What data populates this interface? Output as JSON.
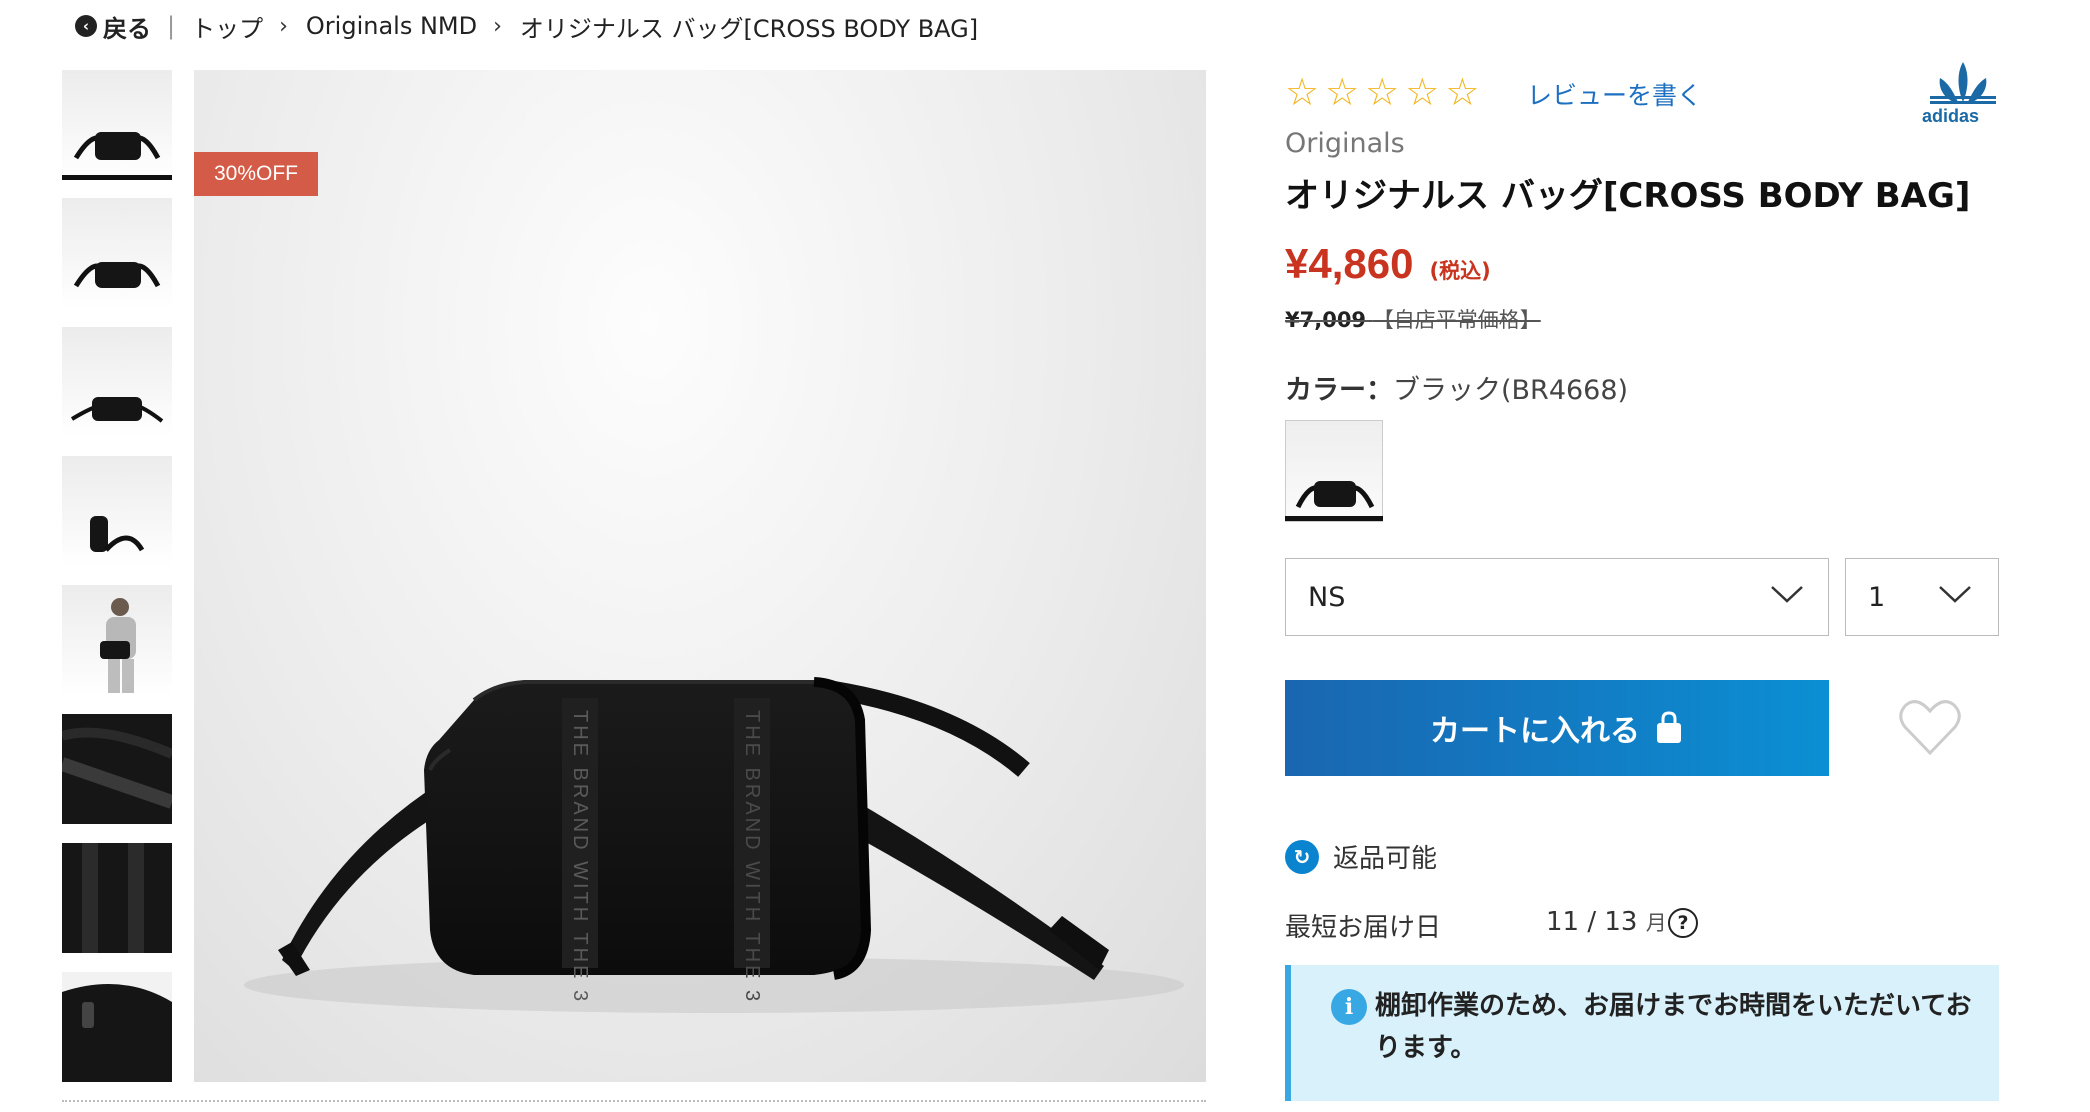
{
  "breadcrumb": {
    "back_label": "戻る",
    "separator": "|",
    "items": [
      "トップ",
      "Originals NMD",
      "オリジナルス バッグ[CROSS BODY BAG]"
    ]
  },
  "gallery": {
    "thumbnail_count": 8,
    "active_index": 0,
    "badge": "30%OFF",
    "bag_print_text": "THE BRAND WITH THE 3"
  },
  "product": {
    "rating_stars": 5,
    "rating_value": 0,
    "review_link": "レビューを書く",
    "brand": "adidas",
    "category": "Originals",
    "title": "オリジナルス バッグ[CROSS BODY BAG]",
    "price": "¥4,860",
    "tax_note": "(税込)",
    "original_price": "¥7,009",
    "original_price_note": "【自店平常価格】",
    "color_label": "カラー：",
    "color_value": "ブラック(BR4668)"
  },
  "size_select": {
    "value": "NS"
  },
  "quantity_select": {
    "value": "1"
  },
  "cart_button": {
    "label": "カートに入れる"
  },
  "returns": {
    "label": "返品可能"
  },
  "delivery": {
    "label": "最短お届け日",
    "date": "11 / 13",
    "weekday": "月"
  },
  "notice": {
    "text": "棚卸作業のため、お届けまでお時間をいただいております。"
  },
  "colors": {
    "price": "#c8341f",
    "badge": "#d45b47",
    "cart_start": "#1a66b0",
    "cart_end": "#0b8fd4",
    "link": "#1c6fc1",
    "star": "#f2b51d",
    "notice_bg": "#d9f1fb"
  },
  "icons": {
    "back": "back-arrow-icon",
    "chevron": "chevron-right-icon",
    "star": "star-outline-icon",
    "logo": "adidas-trefoil-logo",
    "select": "chevron-down-icon",
    "cart": "shopping-bag-lock-icon",
    "wishlist": "heart-outline-icon",
    "returns": "return-arrow-icon",
    "help": "question-mark-icon",
    "info": "info-icon"
  }
}
